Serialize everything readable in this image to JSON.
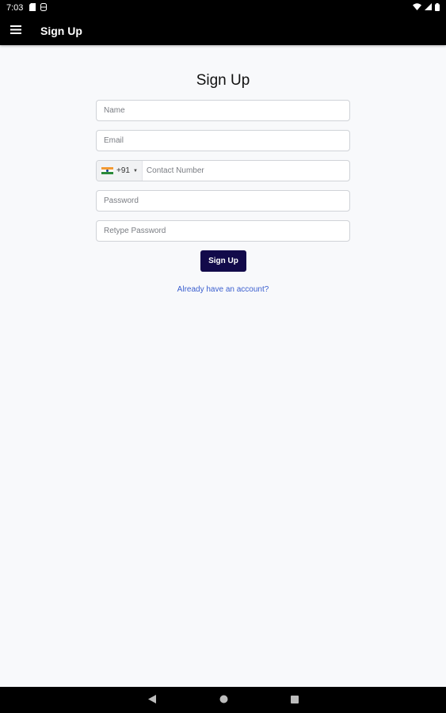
{
  "status_bar": {
    "time": "7:03"
  },
  "app_bar": {
    "title": "Sign Up"
  },
  "form": {
    "heading": "Sign Up",
    "name_placeholder": "Name",
    "email_placeholder": "Email",
    "phone": {
      "dial_code": "+91",
      "placeholder": "Contact Number",
      "country_flag": "india-flag-icon"
    },
    "password_placeholder": "Password",
    "retype_password_placeholder": "Retype Password",
    "submit_label": "Sign Up",
    "login_link": "Already have an account?"
  },
  "colors": {
    "app_bar": "#000000",
    "button": "#120a4a",
    "link": "#3b5fcf",
    "background": "#f8f9fb"
  }
}
